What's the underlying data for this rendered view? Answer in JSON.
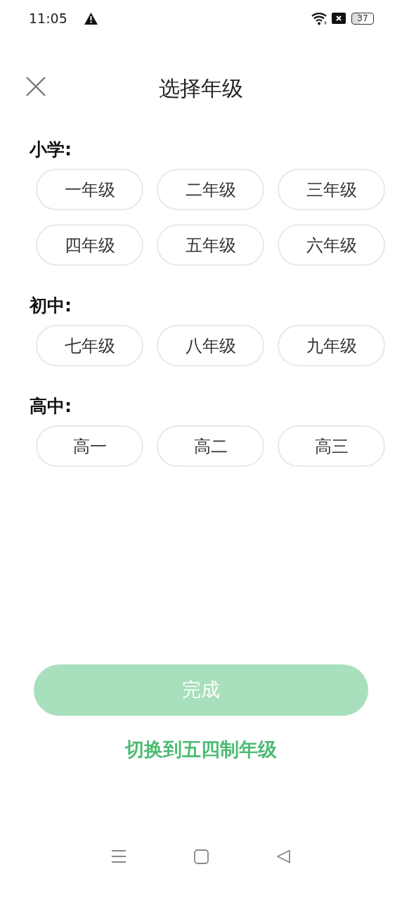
{
  "status_bar": {
    "time": "11:05",
    "battery": "37"
  },
  "header": {
    "title": "选择年级"
  },
  "sections": [
    {
      "label": "小学:",
      "grades": [
        {
          "label": "一年级",
          "selected": false
        },
        {
          "label": "二年级",
          "selected": false
        },
        {
          "label": "三年级",
          "selected": false
        },
        {
          "label": "四年级",
          "selected": false
        },
        {
          "label": "五年级",
          "selected": false
        },
        {
          "label": "六年级",
          "selected": false
        }
      ]
    },
    {
      "label": "初中:",
      "grades": [
        {
          "label": "七年级",
          "selected": false
        },
        {
          "label": "八年级",
          "selected": false
        },
        {
          "label": "九年级",
          "selected": false
        }
      ]
    },
    {
      "label": "高中:",
      "grades": [
        {
          "label": "高一",
          "selected": false
        },
        {
          "label": "高二",
          "selected": false
        },
        {
          "label": "高三",
          "selected": false
        }
      ]
    }
  ],
  "done_button": {
    "label": "完成",
    "disabled": true
  },
  "switch_link": {
    "label": "切换到五四制年级"
  }
}
